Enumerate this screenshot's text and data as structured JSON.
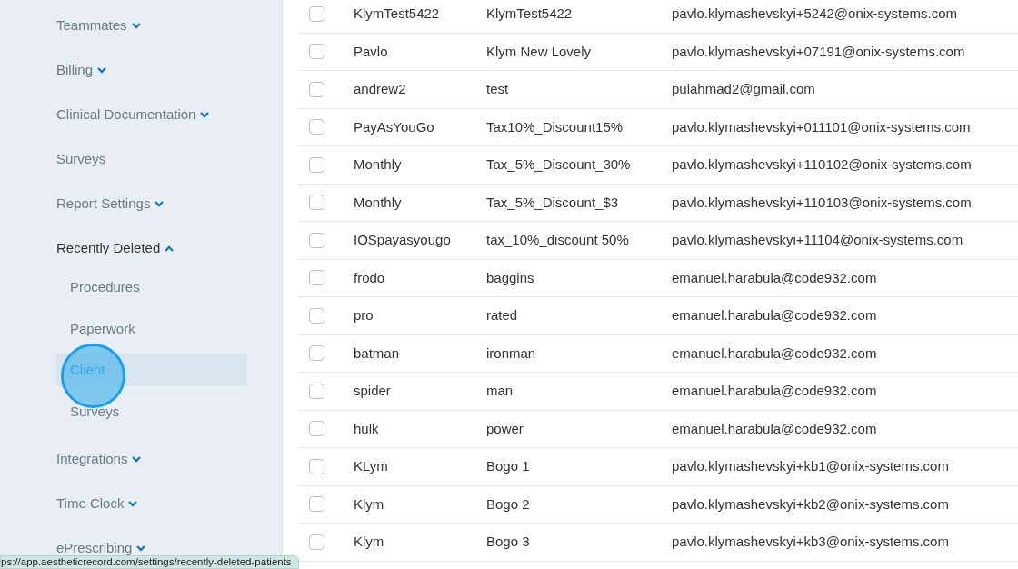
{
  "sidebar": {
    "items": [
      {
        "label": "Teammates",
        "expanded": false
      },
      {
        "label": "Billing",
        "expanded": false
      },
      {
        "label": "Clinical Documentation",
        "expanded": false
      },
      {
        "label": "Surveys"
      },
      {
        "label": "Report Settings",
        "expanded": false
      },
      {
        "label": "Recently Deleted",
        "expanded": true,
        "children": [
          {
            "label": "Procedures",
            "selected": false
          },
          {
            "label": "Paperwork",
            "selected": false
          },
          {
            "label": "Client",
            "selected": true
          },
          {
            "label": "Surveys",
            "selected": false
          }
        ]
      },
      {
        "label": "Integrations",
        "expanded": false
      },
      {
        "label": "Time Clock",
        "expanded": false
      },
      {
        "label": "ePrescribing",
        "expanded": false
      }
    ]
  },
  "table": {
    "rows": [
      {
        "checked": false,
        "first_name": "KlymTest5422",
        "last_name": "KlymTest5422",
        "email": "pavlo.klymashevskyi+5242@onix-systems.com"
      },
      {
        "checked": false,
        "first_name": "Pavlo",
        "last_name": "Klym New Lovely",
        "email": "pavlo.klymashevskyi+07191@onix-systems.com"
      },
      {
        "checked": false,
        "first_name": "andrew2",
        "last_name": "test",
        "email": "pulahmad2@gmail.com"
      },
      {
        "checked": false,
        "first_name": "PayAsYouGo",
        "last_name": "Tax10%_Discount15%",
        "email": "pavlo.klymashevskyi+011101@onix-systems.com"
      },
      {
        "checked": false,
        "first_name": "Monthly",
        "last_name": "Tax_5%_Discount_30%",
        "email": "pavlo.klymashevskyi+110102@onix-systems.com"
      },
      {
        "checked": false,
        "first_name": "Monthly",
        "last_name": "Tax_5%_Discount_$3",
        "email": "pavlo.klymashevskyi+110103@onix-systems.com"
      },
      {
        "checked": false,
        "first_name": "IOSpayasyougo",
        "last_name": "tax_10%_discount 50%",
        "email": "pavlo.klymashevskyi+11104@onix-systems.com"
      },
      {
        "checked": false,
        "first_name": "frodo",
        "last_name": "baggins",
        "email": "emanuel.harabula@code932.com"
      },
      {
        "checked": false,
        "first_name": "pro",
        "last_name": "rated",
        "email": "emanuel.harabula@code932.com"
      },
      {
        "checked": false,
        "first_name": "batman",
        "last_name": "ironman",
        "email": "emanuel.harabula@code932.com"
      },
      {
        "checked": false,
        "first_name": "spider",
        "last_name": "man",
        "email": "emanuel.harabula@code932.com"
      },
      {
        "checked": false,
        "first_name": "hulk",
        "last_name": "power",
        "email": "emanuel.harabula@code932.com"
      },
      {
        "checked": false,
        "first_name": "KLym",
        "last_name": "Bogo 1",
        "email": "pavlo.klymashevskyi+kb1@onix-systems.com"
      },
      {
        "checked": false,
        "first_name": "Klym",
        "last_name": "Bogo 2",
        "email": "pavlo.klymashevskyi+kb2@onix-systems.com"
      },
      {
        "checked": false,
        "first_name": "Klym",
        "last_name": "Bogo 3",
        "email": "pavlo.klymashevskyi+kb3@onix-systems.com"
      }
    ]
  },
  "status_bar": {
    "url": "ps://app.aestheticrecord.com/settings/recently-deleted-patients"
  }
}
